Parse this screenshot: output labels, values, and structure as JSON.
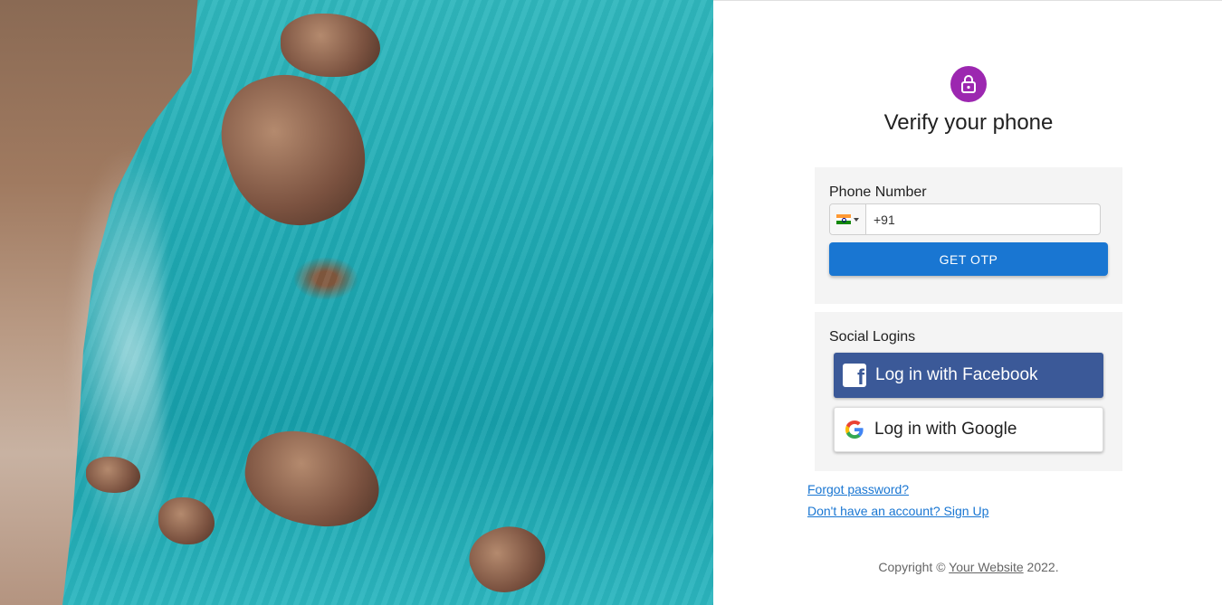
{
  "hero": {
    "image_name": "coastal-ocean-photo"
  },
  "form": {
    "title": "Verify your phone",
    "icon": "lock-icon",
    "accent_color": "#9c27b0",
    "phone": {
      "label": "Phone Number",
      "country_flag": "india-flag-icon",
      "value": "+91",
      "button_label": "GET OTP",
      "button_color": "#1976d2"
    },
    "social": {
      "label": "Social Logins",
      "facebook_label": "Log in with Facebook",
      "facebook_color": "#3b5998",
      "google_label": "Log in with Google"
    },
    "links": {
      "forgot": "Forgot password?",
      "signup": "Don't have an account? Sign Up"
    },
    "footer": {
      "prefix": "Copyright ©",
      "site_link": "Your Website",
      "year": "2022."
    }
  }
}
